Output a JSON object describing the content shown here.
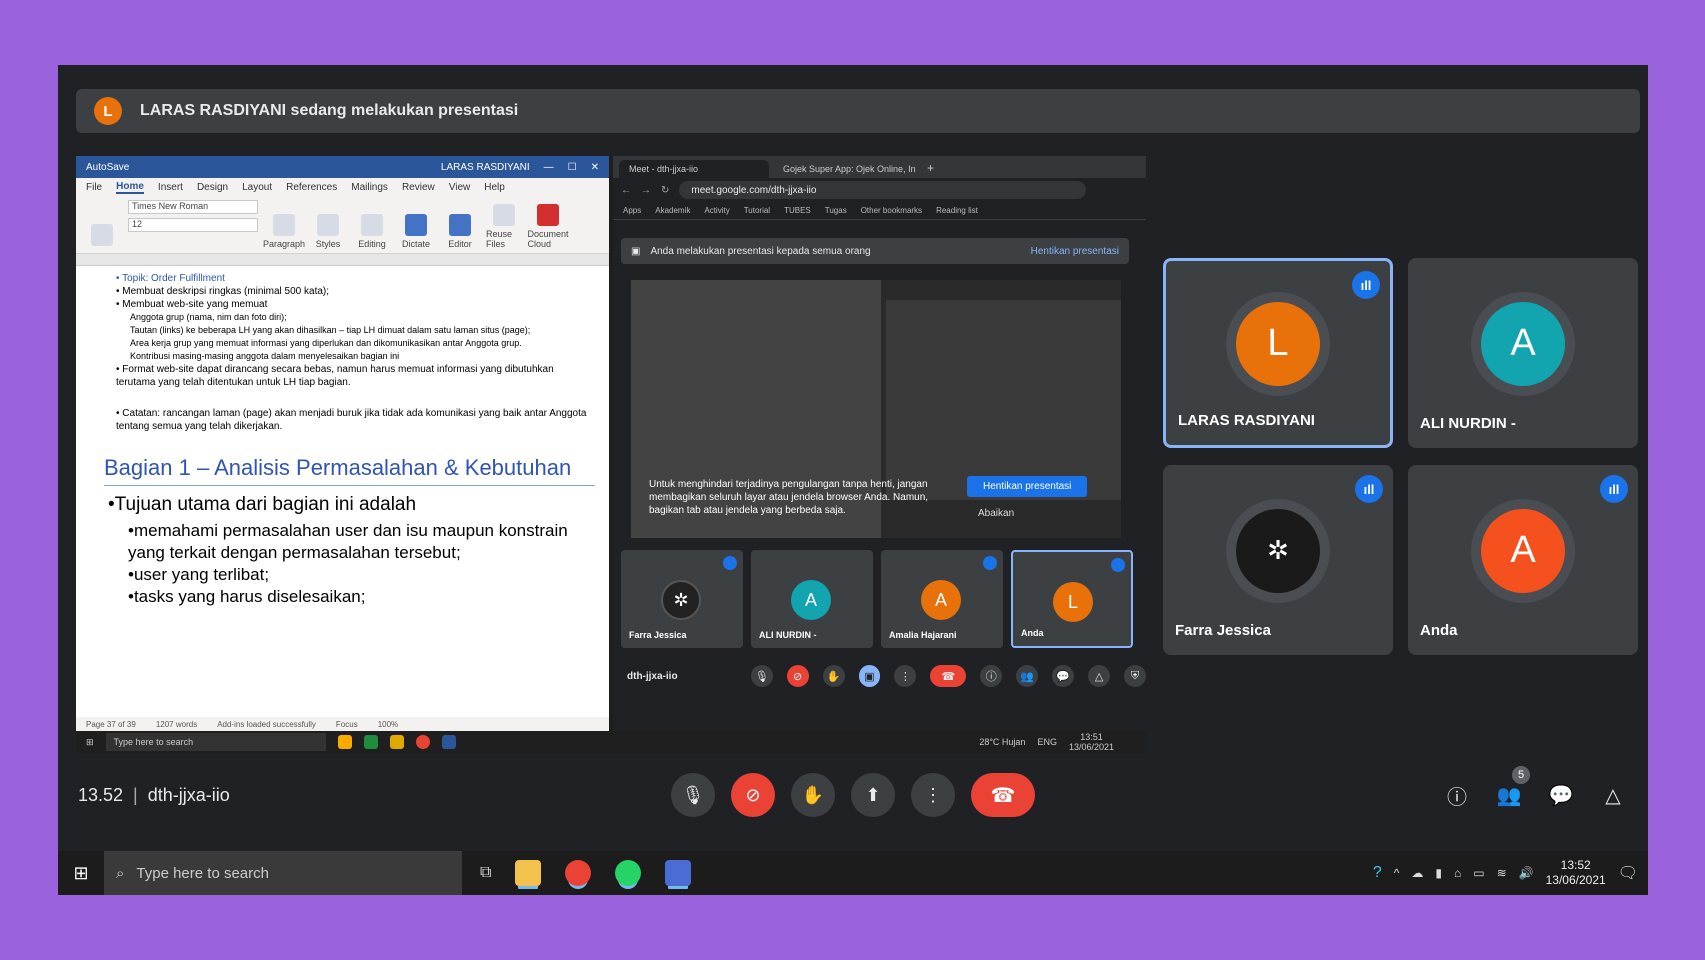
{
  "banner": {
    "avatar_letter": "L",
    "text": "LARAS RASDIYANI sedang melakukan presentasi"
  },
  "word": {
    "title_left": "AutoSave",
    "title_user": "LARAS RASDIYANI",
    "menu": [
      "File",
      "Home",
      "Insert",
      "Design",
      "Layout",
      "References",
      "Mailings",
      "Review",
      "View",
      "Help"
    ],
    "font_name": "Times New Roman",
    "font_size": "12",
    "ribbon": [
      "Paragraph",
      "Styles",
      "Editing",
      "Dictate",
      "Editor",
      "Reuse Files",
      "Document Cloud"
    ],
    "lines": [
      "• Topik: Order Fulfillment",
      "• Membuat deskripsi ringkas (minimal 500 kata);",
      "• Membuat web-site yang memuat",
      "Anggota grup (nama, nim dan foto diri);",
      "Tautan (links) ke beberapa LH yang akan dihasilkan – tiap LH dimuat dalam satu laman situs (page);",
      "Area kerja grup yang memuat informasi yang diperlukan dan dikomunikasikan antar Anggota grup.",
      "Kontribusi masing-masing anggota dalam menyelesaikan bagian ini",
      "• Format web-site dapat dirancang secara bebas, namun harus memuat informasi yang dibutuhkan terutama yang telah ditentukan untuk LH tiap bagian.",
      "• Catatan: rancangan laman (page) akan menjadi buruk jika tidak ada komunikasi yang baik antar Anggota tentang semua yang telah dikerjakan."
    ],
    "heading": "Bagian 1 – Analisis Permasalahan & Kebutuhan",
    "bullet_main": "•Tujuan utama dari bagian ini adalah",
    "bullets": [
      "•memahami permasalahan user dan isu maupun konstrain yang terkait dengan permasalahan tersebut;",
      "•user yang terlibat;",
      "•tasks yang harus diselesaikan;"
    ],
    "status": [
      "Page 37 of 39",
      "1207 words",
      "Add-ins loaded successfully",
      "Focus",
      "100%"
    ]
  },
  "chrome": {
    "tabs": [
      "Meet - dth-jjxa-iio",
      "Gojek Super App: Ojek Online, In"
    ],
    "url": "meet.google.com/dth-jjxa-iio",
    "bookmarks": [
      "Apps",
      "Akademik",
      "Activity",
      "Tutorial",
      "TUBES",
      "Tugas",
      "Other bookmarks",
      "Reading list"
    ],
    "pres_msg": "Anda melakukan presentasi kepada semua orang",
    "pres_stop": "Hentikan presentasi",
    "warning": "Untuk menghindari terjadinya pengulangan tanpa henti, jangan membagikan seluruh layar atau jendela browser Anda. Namun, bagikan tab atau jendela yang berbeda saja.",
    "stop_button": "Hentikan presentasi",
    "ignore": "Abaikan",
    "mini_tiles": [
      {
        "name": "Farra Jessica",
        "letter": "",
        "color": "#222222"
      },
      {
        "name": "ALI NURDIN -",
        "letter": "A",
        "color": "#12a4af"
      },
      {
        "name": "Amalia Hajarani",
        "letter": "A",
        "color": "#e8710a"
      },
      {
        "name": "Anda",
        "letter": "L",
        "color": "#e8710a"
      }
    ],
    "code": "dth-jjxa-iio",
    "taskbar_search": "Type here to search",
    "weather": "28°C Hujan",
    "lang": "ENG",
    "time": "13:51",
    "date": "13/06/2021"
  },
  "tiles": [
    {
      "name": "LARAS RASDIYANI",
      "letter": "L",
      "color": "#e8710a"
    },
    {
      "name": "ALI NURDIN -",
      "letter": "A",
      "color": "#12a4af"
    },
    {
      "name": "Farra Jessica",
      "letter": "",
      "color": "#1a1a1a"
    },
    {
      "name": "Anda",
      "letter": "A",
      "color": "#f4511e"
    }
  ],
  "meet": {
    "time": "13.52",
    "code": "dth-jjxa-iio",
    "participants_count": "5"
  },
  "taskbar": {
    "search": "Type here to search",
    "time": "13:52",
    "date": "13/06/2021"
  }
}
